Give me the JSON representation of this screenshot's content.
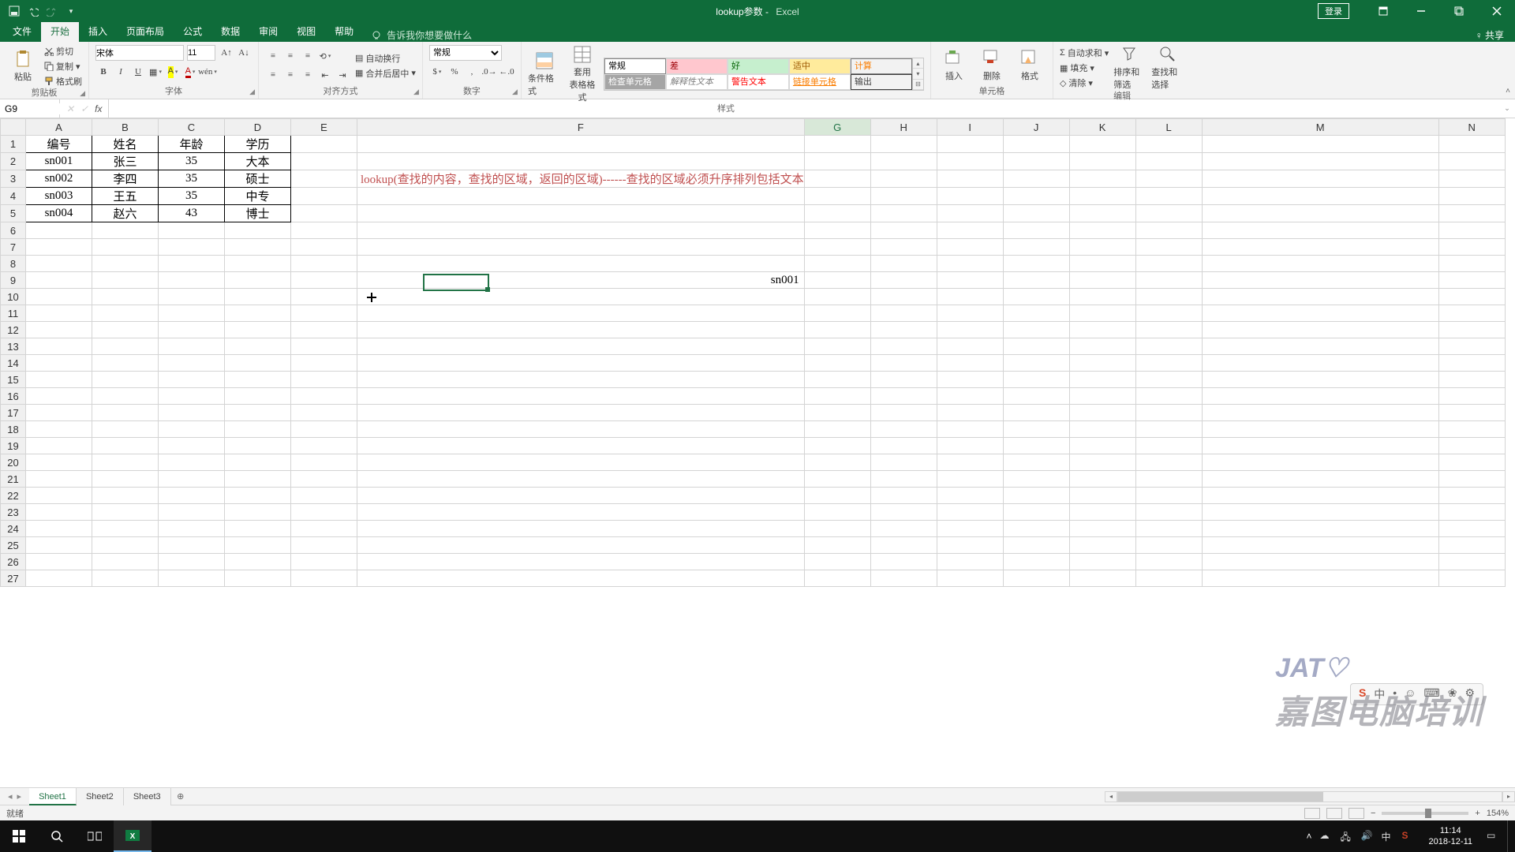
{
  "titlebar": {
    "doc": "lookup参数",
    "app": "Excel",
    "login": "登录"
  },
  "tabs": {
    "file": "文件",
    "home": "开始",
    "insert": "插入",
    "layout": "页面布局",
    "formulas": "公式",
    "data": "数据",
    "review": "审阅",
    "view": "视图",
    "help": "帮助",
    "tellme": "告诉我你想要做什么",
    "share": "共享"
  },
  "ribbon": {
    "clipboard": {
      "paste": "粘贴",
      "cut": "剪切",
      "copy": "复制",
      "formatpainter": "格式刷",
      "label": "剪贴板"
    },
    "font": {
      "name": "宋体",
      "size": "11",
      "label": "字体"
    },
    "align": {
      "wrap": "自动换行",
      "merge": "合并后居中",
      "label": "对齐方式"
    },
    "number": {
      "fmt": "常规",
      "label": "数字"
    },
    "styles": {
      "condfmt": "条件格式",
      "table": "套用\n表格格式",
      "gallery": [
        {
          "t": "常规",
          "bg": "#ffffff",
          "fg": "#000",
          "bd": "#888"
        },
        {
          "t": "差",
          "bg": "#ffc7ce",
          "fg": "#9c0006"
        },
        {
          "t": "好",
          "bg": "#c6efce",
          "fg": "#006100"
        },
        {
          "t": "适中",
          "bg": "#ffeb9c",
          "fg": "#9c5700"
        },
        {
          "t": "计算",
          "bg": "#f2f2f2",
          "fg": "#fa7d00",
          "bd": "#7f7f7f"
        },
        {
          "t": "检查单元格",
          "bg": "#a5a5a5",
          "fg": "#ffffff"
        },
        {
          "t": "解释性文本",
          "bg": "#ffffff",
          "fg": "#7f7f7f",
          "it": true
        },
        {
          "t": "警告文本",
          "bg": "#ffffff",
          "fg": "#ff0000"
        },
        {
          "t": "链接单元格",
          "bg": "#ffffff",
          "fg": "#fa7d00",
          "u": true
        },
        {
          "t": "输出",
          "bg": "#f2f2f2",
          "fg": "#3f3f3f",
          "bd": "#3f3f3f"
        }
      ],
      "label": "样式"
    },
    "cells": {
      "insert": "插入",
      "delete": "删除",
      "format": "格式",
      "label": "单元格"
    },
    "editing": {
      "sum": "自动求和",
      "fill": "填充",
      "clear": "清除",
      "sort": "排序和筛选",
      "find": "查找和选择",
      "label": "编辑"
    }
  },
  "fbar": {
    "name": "G9",
    "formula": ""
  },
  "columns": [
    "A",
    "B",
    "C",
    "D",
    "E",
    "F",
    "G",
    "H",
    "I",
    "J",
    "K",
    "L",
    "M",
    "N"
  ],
  "rows": 27,
  "data": {
    "headers": [
      "编号",
      "姓名",
      "年龄",
      "学历"
    ],
    "rows": [
      [
        "sn001",
        "张三",
        "35",
        "大本"
      ],
      [
        "sn002",
        "李四",
        "35",
        "硕士"
      ],
      [
        "sn003",
        "王五",
        "35",
        "中专"
      ],
      [
        "sn004",
        "赵六",
        "43",
        "博士"
      ]
    ],
    "note": "lookup(查找的内容，查找的区域，返回的区域)------查找的区域必须升序排列包括文本",
    "f9": "sn001"
  },
  "chart_data": {
    "type": "table",
    "title": "",
    "columns": [
      "编号",
      "姓名",
      "年龄",
      "学历"
    ],
    "rows": [
      [
        "sn001",
        "张三",
        35,
        "大本"
      ],
      [
        "sn002",
        "李四",
        35,
        "硕士"
      ],
      [
        "sn003",
        "王五",
        35,
        "中专"
      ],
      [
        "sn004",
        "赵六",
        43,
        "博士"
      ]
    ]
  },
  "sheets": {
    "s1": "Sheet1",
    "s2": "Sheet2",
    "s3": "Sheet3"
  },
  "status": {
    "ready": "就绪",
    "zoom": "154%"
  },
  "watermark": {
    "logo": "JAT♡",
    "text": "嘉图电脑培训"
  },
  "ime": {
    "items": [
      "中",
      "•",
      "☺",
      "⌨",
      "❀",
      "⚙"
    ]
  },
  "taskbar": {
    "time": "11:14",
    "date": "2018-12-11"
  }
}
